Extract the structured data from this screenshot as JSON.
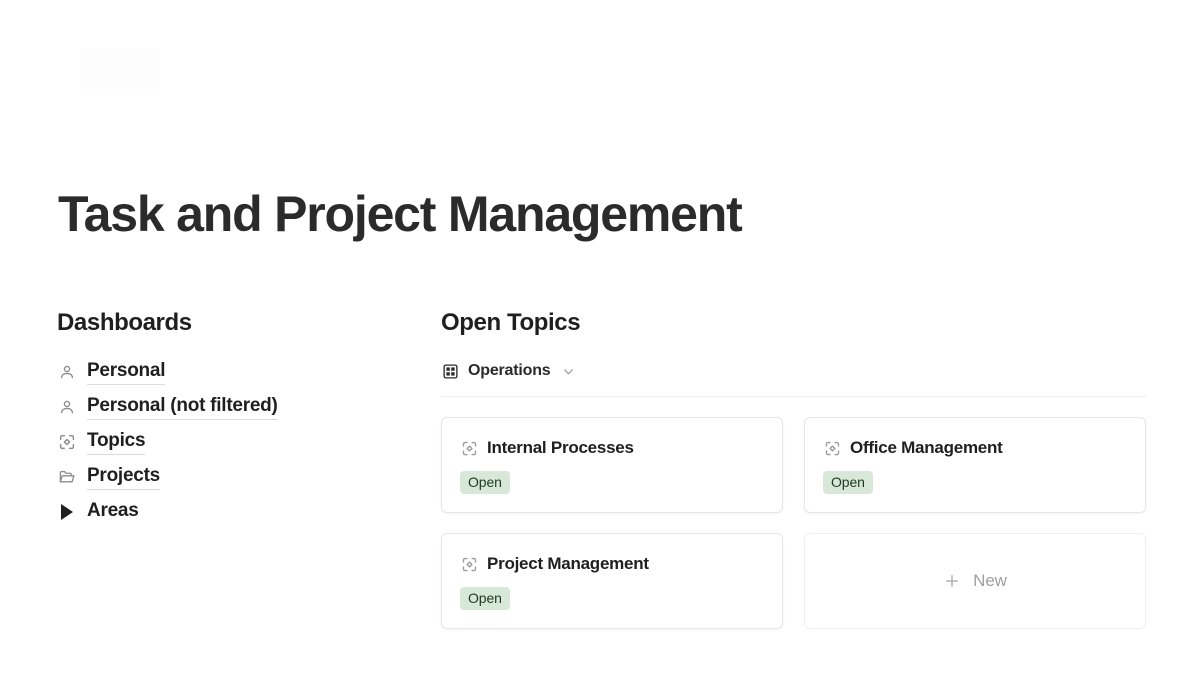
{
  "page": {
    "title": "Task and Project Management"
  },
  "sidebar": {
    "heading": "Dashboards",
    "items": [
      {
        "label": "Personal",
        "icon": "person-icon",
        "underlined": true
      },
      {
        "label": "Personal (not filtered)",
        "icon": "person-icon",
        "underlined": true
      },
      {
        "label": "Topics",
        "icon": "focus-icon",
        "underlined": true
      },
      {
        "label": "Projects",
        "icon": "folder-icon",
        "underlined": true
      },
      {
        "label": "Areas",
        "icon": "triangle-right-icon",
        "underlined": false
      }
    ]
  },
  "main": {
    "heading": "Open Topics",
    "view": {
      "icon": "gallery-view-icon",
      "label": "Operations",
      "chevron": "chevron-down-icon"
    },
    "cards": [
      {
        "title": "Internal Processes",
        "icon": "focus-icon",
        "status": "Open"
      },
      {
        "title": "Office Management",
        "icon": "focus-icon",
        "status": "Open"
      },
      {
        "title": "Project Management",
        "icon": "focus-icon",
        "status": "Open"
      }
    ],
    "new_card": {
      "label": "New",
      "icon": "plus-icon"
    }
  },
  "colors": {
    "background": "#ffffff",
    "text": "#1f1f1f",
    "muted": "#a0a0a0",
    "card_border": "#e6e6e6",
    "divider": "#ececec",
    "badge_bg": "#d7e8d8",
    "badge_text": "#1c3a22"
  }
}
